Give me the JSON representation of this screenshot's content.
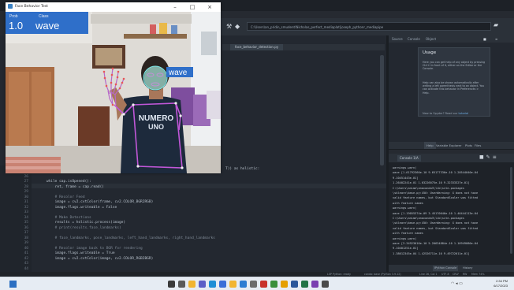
{
  "camera_window": {
    "title": "Face Behavior Test",
    "minimize": "–",
    "maximize": "□",
    "close": "×",
    "overlay_header": "Class",
    "overlay_prob_label": "Prob",
    "probability": "1.0",
    "class_label": "wave",
    "face_label": "wave",
    "shirt_text_line1": "NUMERO",
    "shirt_text_line2": "UNO"
  },
  "ide": {
    "path": "C:\\Users\\an_pridin_smudent\\Nicholas_perfect_mediaplat\\joseph_pythonr_mediapipe",
    "editor_tab": "face_behavior_detection.py",
    "code_lines": [
      {
        "n": "25",
        "t": "",
        "c": false
      },
      {
        "n": "26",
        "t": "",
        "c": false
      },
      {
        "n": "27",
        "t": "    while cap.isOpened():",
        "c": false
      },
      {
        "n": "28",
        "t": "        ret, frame = cap.read()",
        "c": false
      },
      {
        "n": "29",
        "t": "",
        "c": false
      },
      {
        "n": "30",
        "t": "        # Recolor Feed",
        "c": true
      },
      {
        "n": "31",
        "t": "        image = cv2.cvtColor(frame, cv2.COLOR_BGR2RGB)",
        "c": false
      },
      {
        "n": "32",
        "t": "        image.flags.writeable = False",
        "c": false
      },
      {
        "n": "33",
        "t": "",
        "c": false
      },
      {
        "n": "34",
        "t": "        # Make Detections",
        "c": true
      },
      {
        "n": "35",
        "t": "        results = holistic.process(image)",
        "c": false
      },
      {
        "n": "36",
        "t": "        # print(results.face_landmarks)",
        "c": true
      },
      {
        "n": "37",
        "t": "",
        "c": false
      },
      {
        "n": "38",
        "t": "        # face_landmarks, pose_landmarks, left_hand_landmarks, right_hand_landmarks",
        "c": true
      },
      {
        "n": "39",
        "t": "",
        "c": false
      },
      {
        "n": "40",
        "t": "        # Recolor image back to BGR for rendering",
        "c": true
      },
      {
        "n": "41",
        "t": "        image.flags.writeable = True",
        "c": false
      },
      {
        "n": "42",
        "t": "        image = cv2.cvtColor(image, cv2.COLOR_RGB2BGR)",
        "c": false
      },
      {
        "n": "43",
        "t": "",
        "c": false
      },
      {
        "n": "44",
        "t": "",
        "c": false
      }
    ],
    "code_overflow_text": "T)) as holistic:",
    "help_tabs": [
      "Source",
      "Console",
      "Object"
    ],
    "help_title": "Usage",
    "help_text_1": "Here you can get help of any object by pressing Ctrl+I in front of it, either on the Editor or the Console.",
    "help_text_2": "Help can also be shown automatically after writing a left parenthesis next to an object. You can activate this behavior in Preferences > Help.",
    "help_link_prefix": "New to Spyder? Read our",
    "help_link": "tutorial",
    "mid_tabs": [
      "Help",
      "Variable Explorer",
      "Plots",
      "Files"
    ],
    "console_tab": "Console 1/A",
    "console_lines": [
      "  warnings.warn(",
      "wave [1.61792366e-10 9.65177336e-10 1.20544040e-04",
      "9.10451443e-01]",
      "  1.26402241e-01 1.03226075e-10 9.32333327e-01]",
      "C:\\Users\\anime\\anaconda3\\lib\\site-packages",
      "\\sklearn\\base.py:450: UserWarning: X does not have",
      "valid feature names, but StandardScaler was fitted",
      "with feature names",
      "  warnings.warn(",
      "wave [1.19055374e-09 3.45170046e-10 1.46444113e-04",
      "C:\\Users\\anime\\anaconda3\\lib\\site-packages",
      "\\sklearn\\base.py:450: UserWarning: X does not have",
      "valid feature names, but StandardScaler was fitted",
      "with feature names",
      "  warnings.warn(",
      "wave [3.34923016e-10 5.20634884e-10 1.16949080e-04",
      "9.10401251e-01]",
      "  1.38612345e-04 1.42526711e-10 9.49722011e-01]"
    ],
    "console_bottom_tabs": [
      "IPython Console",
      "History"
    ],
    "status": [
      "LSP Python: ready",
      "conda: base (Python 3.9.12)",
      "Line 26, Col 1",
      "UTF-8",
      "CRLF",
      "RW",
      "Mem 74%"
    ]
  },
  "taskbar": {
    "time": "2:34 PM",
    "date": "6/17/2023",
    "icons": [
      "windows-logo",
      "search",
      "task-view",
      "files",
      "chat",
      "edge",
      "store",
      "explorer",
      "mail",
      "settings",
      "spyder",
      "python",
      "chrome",
      "word",
      "excel",
      "media",
      "misc"
    ]
  },
  "colors": {
    "ide_bg": "#232830",
    "overlay_blue": "#2f6fc9",
    "landmark_cyan": "#55e0e0",
    "pose_purple": "#c157d8",
    "hand_purple": "#b768c9"
  }
}
